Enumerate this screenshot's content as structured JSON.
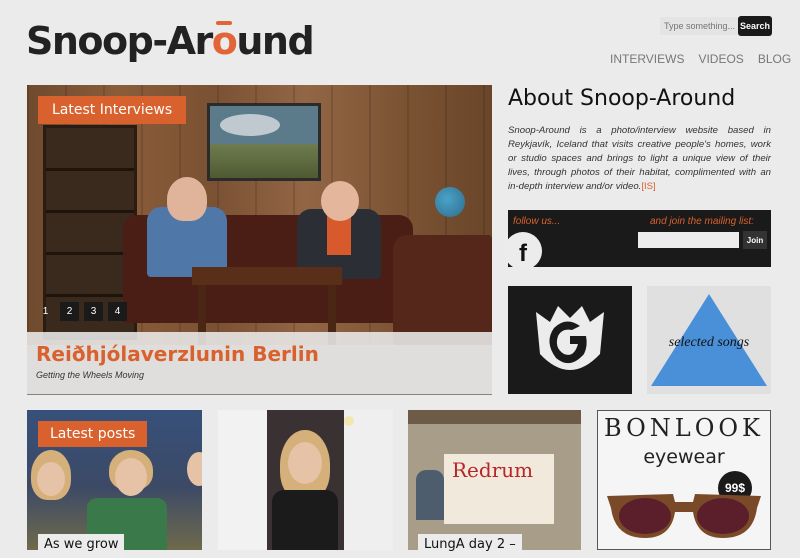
{
  "brand": {
    "name_pre": "Snoop-Ar",
    "name_o": "o",
    "name_post": "und"
  },
  "search": {
    "placeholder": "Type something...",
    "button": "Search"
  },
  "nav": {
    "items": [
      "INTERVIEWS",
      "VIDEOS",
      "BLOG"
    ]
  },
  "featured": {
    "tag": "Latest Interviews",
    "title": "Reiðhjólaverzlunin Berlin",
    "subtitle": "Getting the Wheels Moving",
    "pages": [
      "1",
      "2",
      "3",
      "4"
    ],
    "active_page": "1"
  },
  "about": {
    "heading": "About Snoop-Around",
    "text": "Snoop-Around is a photo/interview website based in Reykjavík, Iceland that visits creative people's homes, work or studio spaces and brings to light a unique view of their lives, through photos of their habitat, complimented with an in-depth interview and/or video.",
    "lang_link": "[IS]"
  },
  "social": {
    "follow_label": "follow us...",
    "mailing_label": "and join the mailing list:",
    "facebook_glyph": "f",
    "join_button": "Join"
  },
  "tiles": {
    "songs_label": "selected songs"
  },
  "posts": {
    "tag": "Latest posts",
    "items": [
      {
        "caption": "As we grow"
      },
      {
        "caption": ""
      },
      {
        "caption": "LungA day 2 –"
      }
    ],
    "redrum_text": "Redrum"
  },
  "ad": {
    "brand": "BONLOOK",
    "sub": "eyewear",
    "price": "99$"
  },
  "colors": {
    "accent": "#d9612e",
    "dark": "#1a1a1a",
    "background": "#ebebeb",
    "triangle": "#4a90d9"
  }
}
